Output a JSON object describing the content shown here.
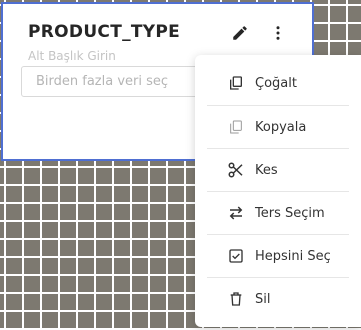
{
  "card": {
    "title": "PRODUCT_TYPE",
    "subtitle_placeholder": "Alt Başlık Girin",
    "select_placeholder": "Birden fazla veri seç"
  },
  "icons": {
    "edit": "pencil-icon",
    "more": "more-vertical-icon"
  },
  "menu": {
    "items": [
      {
        "label": "Çoğalt",
        "icon": "duplicate-icon"
      },
      {
        "label": "Kopyala",
        "icon": "copy-icon"
      },
      {
        "label": "Kes",
        "icon": "scissors-icon"
      },
      {
        "label": "Ters Seçim",
        "icon": "swap-icon"
      },
      {
        "label": "Hepsini Seç",
        "icon": "checkbox-icon"
      },
      {
        "label": "Sil",
        "icon": "trash-icon"
      }
    ]
  },
  "colors": {
    "card_border": "#4f6fd2",
    "canvas_bg": "#7d7970",
    "grid_line": "#ffffff"
  }
}
